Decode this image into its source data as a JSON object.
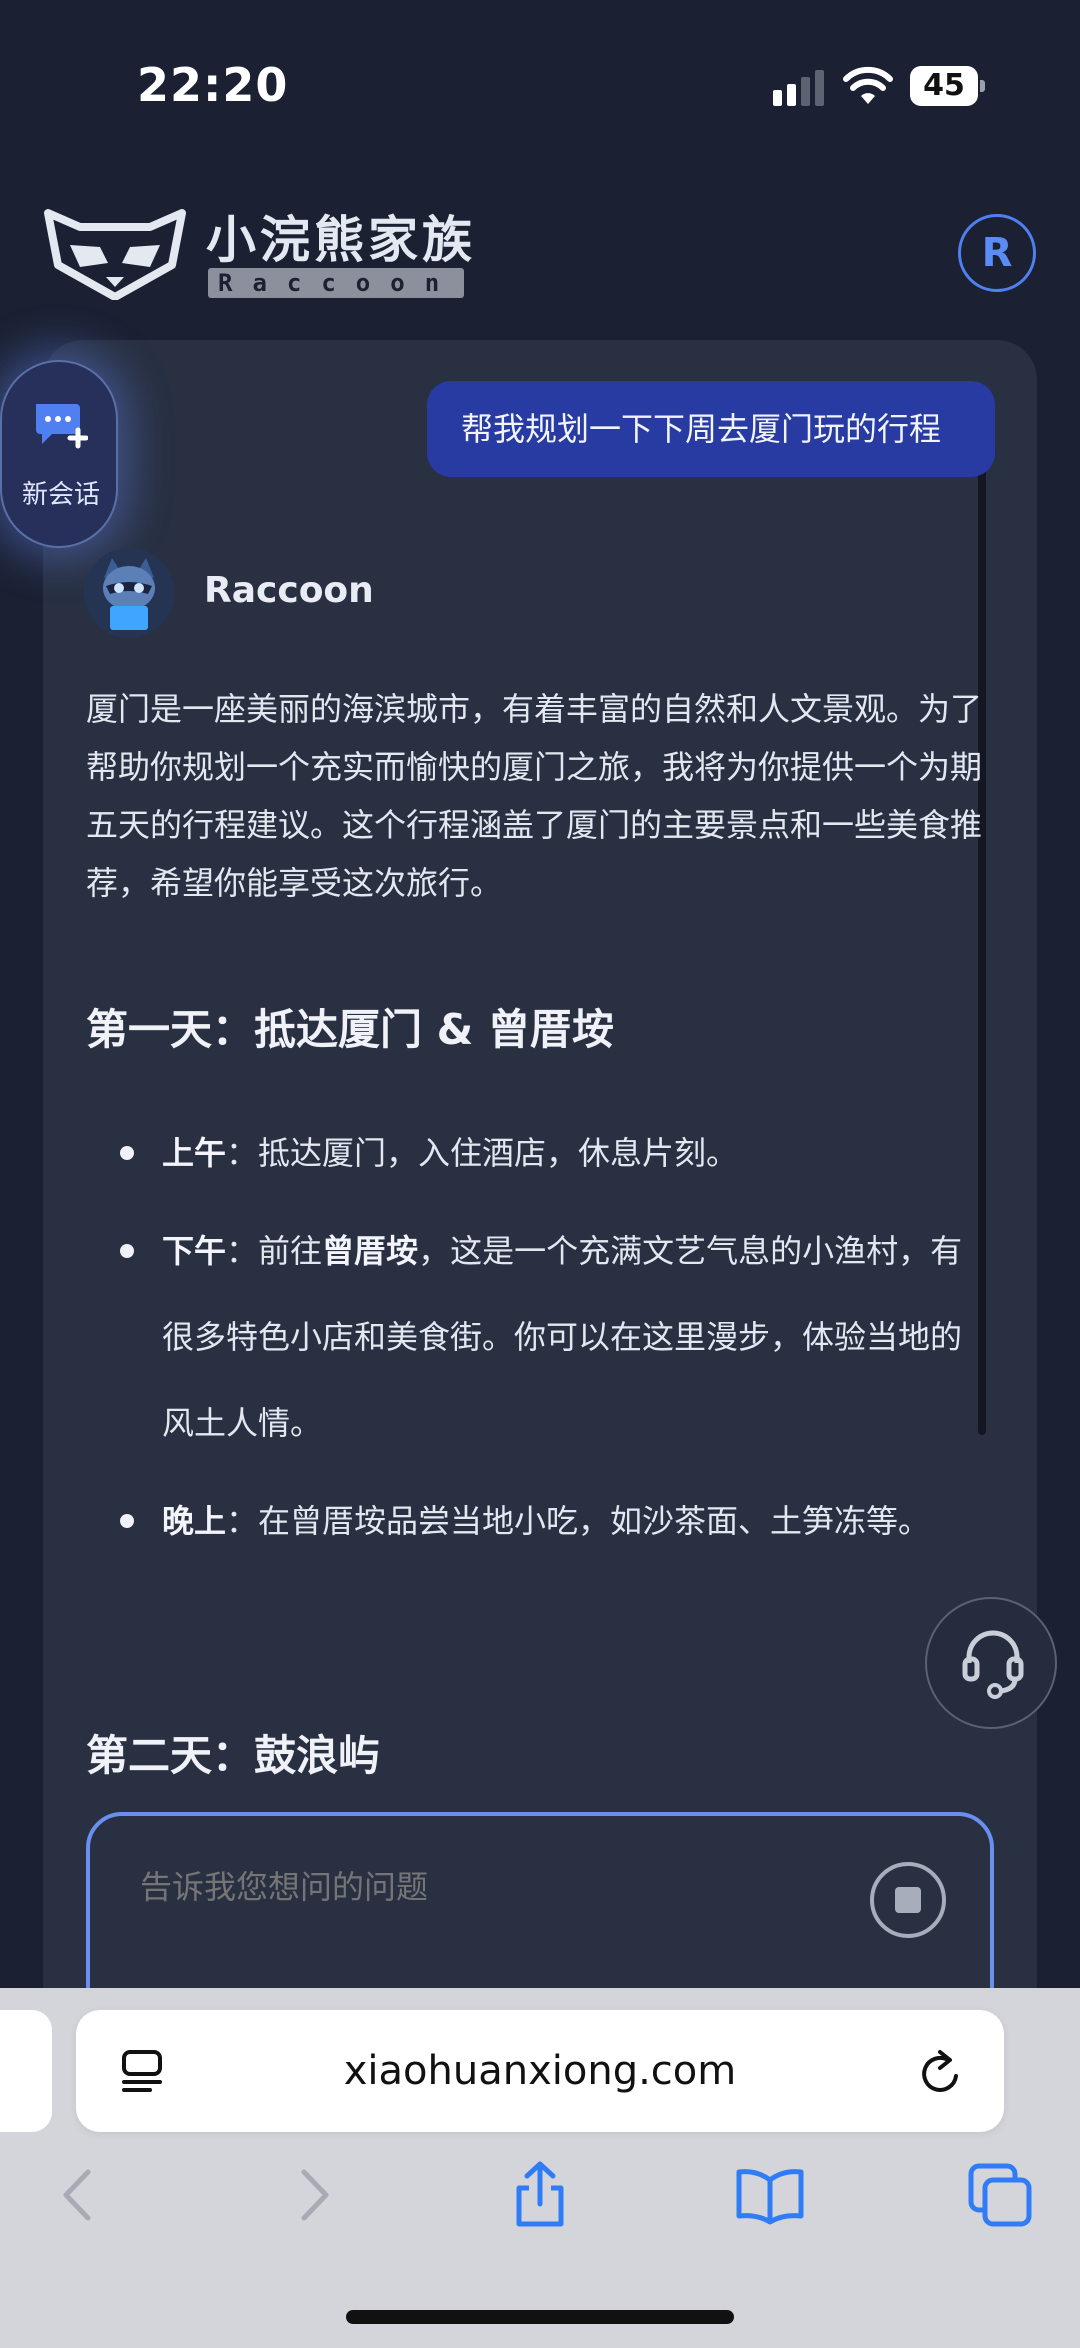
{
  "status_bar": {
    "time": "22:20",
    "battery": "45",
    "icons": [
      "signal-icon",
      "wifi-icon",
      "battery-icon"
    ]
  },
  "header": {
    "brand_name": "小浣熊家族",
    "brand_sub": "Raccoon",
    "user_avatar_letter": "R"
  },
  "sidebar": {
    "new_chat_label": "新会话"
  },
  "chat": {
    "user_message": "帮我规划一下下周去厦门玩的行程",
    "bot_name": "Raccoon",
    "intro": "厦门是一座美丽的海滨城市，有着丰富的自然和人文景观。为了帮助你规划一个充实而愉快的厦门之旅，我将为你提供一个为期五天的行程建议。这个行程涵盖了厦门的主要景点和一些美食推荐，希望你能享受这次旅行。",
    "day1": {
      "heading": "第一天：抵达厦门 & 曾厝垵",
      "items": [
        {
          "label": "上午",
          "sep": "：",
          "text": "抵达厦门，入住酒店，休息片刻。"
        },
        {
          "label": "下午",
          "sep": "：",
          "text_before": "前往",
          "bold": "曾厝垵",
          "text_after": "，这是一个充满文艺气息的小渔村，有很多特色小店和美食街。你可以在这里漫步，体验当地的风土人情。"
        },
        {
          "label": "晚上",
          "sep": "：",
          "text": "在曾厝垵品尝当地小吃，如沙茶面、土笋冻等。"
        }
      ]
    },
    "day2": {
      "heading": "第二天：鼓浪屿"
    }
  },
  "input": {
    "placeholder": "告诉我您想问的问题"
  },
  "browser": {
    "url": "xiaohuanxiong.com"
  },
  "colors": {
    "background": "#1b2133",
    "panel": "#283042",
    "user_bubble": "#283ba3",
    "accent": "#6b8ff0",
    "browser_bar": "#d4d5da",
    "browser_icon": "#2f7cf6"
  }
}
